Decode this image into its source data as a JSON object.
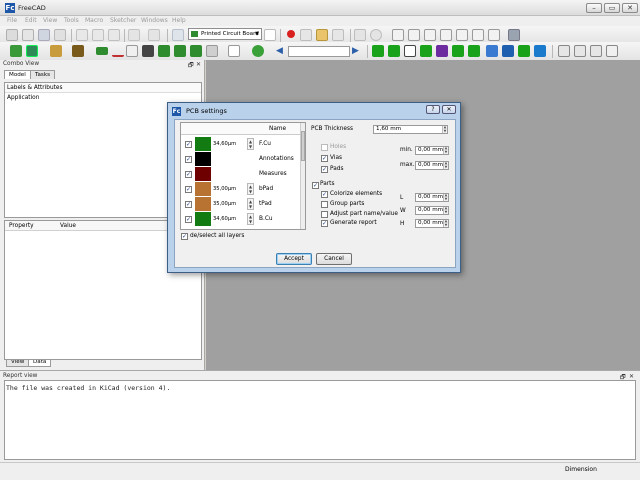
{
  "app": {
    "title": "FreeCAD",
    "logo": "Fc"
  },
  "window_controls": {
    "minimize": "–",
    "maximize": "▭",
    "close": "✕"
  },
  "menu": [
    "File",
    "Edit",
    "View",
    "Tools",
    "Macro",
    "Sketcher",
    "Windows",
    "Help"
  ],
  "toolbar": {
    "workbench": "Printed Circuit Board"
  },
  "combo_view": {
    "title": "Combo View",
    "tabs": [
      "Model",
      "Tasks"
    ],
    "tree_header": "Labels & Attributes",
    "tree_item": "Application",
    "props_columns": [
      "Property",
      "Value"
    ],
    "bottom_tabs": [
      "View",
      "Data"
    ]
  },
  "dock_controls": {
    "float": "🗗",
    "close": "✕"
  },
  "report_view": {
    "title": "Report view",
    "text": "The file was created in KiCad (version 4)."
  },
  "status": {
    "dimension": "Dimension"
  },
  "dialog": {
    "title": "PCB settings",
    "help_btn": "?",
    "close_btn": "✕",
    "table_header_name": "Name",
    "layers": [
      {
        "value": "34,60µm",
        "name": "F.Cu",
        "color": "#127b12",
        "checked": true
      },
      {
        "value": "",
        "name": "Annotations",
        "color": "#000000",
        "checked": true
      },
      {
        "value": "",
        "name": "Measures",
        "color": "#6e0000",
        "checked": true
      },
      {
        "value": "35,00µm",
        "name": "bPad",
        "color": "#b87333",
        "checked": true
      },
      {
        "value": "35,00µm",
        "name": "tPad",
        "color": "#b87333",
        "checked": true
      },
      {
        "value": "34,60µm",
        "name": "B.Cu",
        "color": "#127b12",
        "checked": true
      }
    ],
    "select_all_label": "de/select all layers",
    "pcb_thickness_label": "PCB Thickness",
    "pcb_thickness_value": "1,60 mm",
    "holes_label": "Holes",
    "vias_label": "Vias",
    "pads_label": "Pads",
    "min_label": "min.",
    "min_value": "0,00 mm",
    "max_label": "max.",
    "max_value": "0,00 mm",
    "parts_label": "Parts",
    "colorize_label": "Colorize elements",
    "group_label": "Group parts",
    "adjust_label": "Adjust part name/value",
    "report_label": "Generate report",
    "L_label": "L",
    "L_value": "0,00 mm",
    "W_label": "W",
    "W_value": "0,00 mm",
    "H_label": "H",
    "H_value": "0,00 mm",
    "accept": "Accept",
    "cancel": "Cancel"
  }
}
